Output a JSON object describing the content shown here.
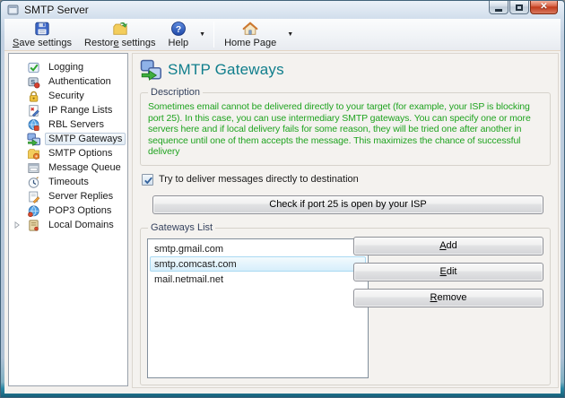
{
  "window": {
    "title": "SMTP Server"
  },
  "toolbar": {
    "save": {
      "pre": "",
      "mn": "S",
      "post": "ave settings"
    },
    "restore": {
      "pre": "Restor",
      "mn": "e",
      "post": " settings"
    },
    "help": {
      "label": "Help"
    },
    "home": {
      "label": "Home Page"
    }
  },
  "sidebar": {
    "selected": "SMTP Gateways",
    "items": [
      {
        "label": "Logging"
      },
      {
        "label": "Authentication"
      },
      {
        "label": "Security"
      },
      {
        "label": "IP Range Lists"
      },
      {
        "label": "RBL Servers"
      },
      {
        "label": "SMTP Gateways"
      },
      {
        "label": "SMTP Options"
      },
      {
        "label": "Message Queue"
      },
      {
        "label": "Timeouts"
      },
      {
        "label": "Server Replies"
      },
      {
        "label": "POP3 Options"
      },
      {
        "label": "Local Domains"
      }
    ]
  },
  "main": {
    "title": "SMTP Gateways",
    "description_label": "Description",
    "description_text": "Sometimes email cannot be delivered directly to your target (for example, your ISP is blocking port 25). In this case, you can use intermediary SMTP gateways. You can specify one or more servers here and if local delivery fails for some reason, they will be tried one after another in sequence until one of them accepts the message. This maximizes the chance of successful delivery",
    "deliver_checkbox": {
      "label": "Try to deliver messages directly to destination",
      "checked": true
    },
    "check_port_button": "Check if port 25 is open by your ISP",
    "gateways": {
      "label": "Gateways List",
      "items": [
        "smtp.gmail.com",
        "smtp.comcast.com",
        "mail.netmail.net"
      ],
      "selected": "smtp.comcast.com"
    },
    "add": {
      "pre": "",
      "mn": "A",
      "post": "dd"
    },
    "edit": {
      "pre": "",
      "mn": "E",
      "post": "dit"
    },
    "remove": {
      "pre": "",
      "mn": "R",
      "post": "emove"
    }
  },
  "colors": {
    "header_teal": "#107e8c",
    "description_green": "#1fa31f",
    "list_selection_border": "#a9d9f2",
    "bottom_frame_teal": "#2a88a4"
  }
}
